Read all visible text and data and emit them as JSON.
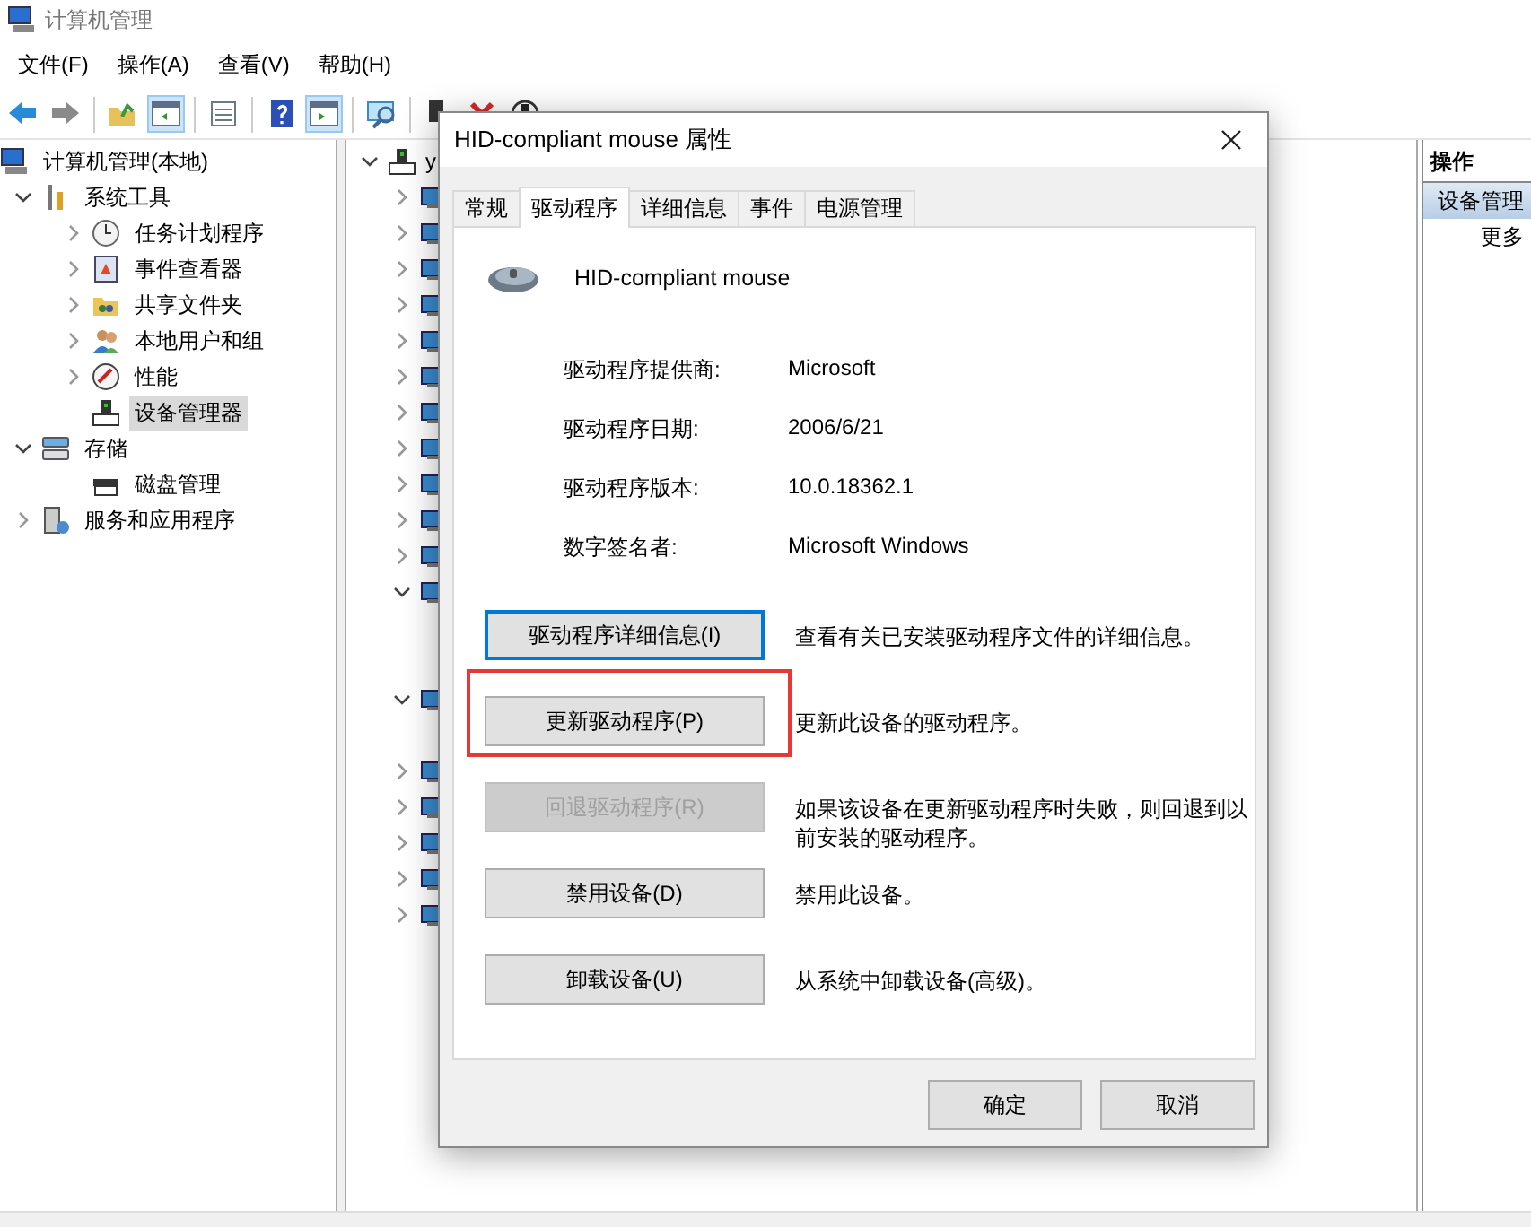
{
  "window": {
    "title": "计算机管理"
  },
  "menu": [
    "文件(F)",
    "操作(A)",
    "查看(V)",
    "帮助(H)"
  ],
  "toolbar": [
    {
      "kind": "back",
      "pressed": false
    },
    {
      "kind": "forward",
      "pressed": false
    },
    {
      "kind": "sep"
    },
    {
      "kind": "up",
      "pressed": false
    },
    {
      "kind": "tree",
      "pressed": true
    },
    {
      "kind": "sep"
    },
    {
      "kind": "export",
      "pressed": false
    },
    {
      "kind": "sep"
    },
    {
      "kind": "help",
      "pressed": false
    },
    {
      "kind": "pane",
      "pressed": true
    },
    {
      "kind": "sep"
    },
    {
      "kind": "scan",
      "pressed": false
    },
    {
      "kind": "sep"
    },
    {
      "kind": "enable",
      "pressed": false
    },
    {
      "kind": "remove",
      "pressed": false
    },
    {
      "kind": "disable",
      "pressed": false
    }
  ],
  "nav_tree": {
    "label": "计算机管理(本地)",
    "selected": false,
    "children": [
      {
        "label": "系统工具",
        "selected": false,
        "expanded": true,
        "children": [
          {
            "label": "任务计划程序",
            "selected": false,
            "expanded": false
          },
          {
            "label": "事件查看器",
            "selected": false,
            "expanded": false
          },
          {
            "label": "共享文件夹",
            "selected": false,
            "expanded": false
          },
          {
            "label": "本地用户和组",
            "selected": false,
            "expanded": false
          },
          {
            "label": "性能",
            "selected": false,
            "expanded": false
          },
          {
            "label": "设备管理器",
            "selected": true
          }
        ]
      },
      {
        "label": "存储",
        "selected": false,
        "expanded": true,
        "children": [
          {
            "label": "磁盘管理",
            "selected": false
          }
        ]
      },
      {
        "label": "服务和应用程序",
        "selected": false,
        "expanded": false
      }
    ]
  },
  "device_tree": {
    "label": "y",
    "expanded": true,
    "categories": [
      {
        "expanded": false
      },
      {
        "expanded": false
      },
      {
        "expanded": false
      },
      {
        "expanded": false
      },
      {
        "expanded": false
      },
      {
        "expanded": false
      },
      {
        "expanded": false
      },
      {
        "expanded": false
      },
      {
        "expanded": false
      },
      {
        "expanded": false
      },
      {
        "expanded": false
      },
      {
        "expanded": true,
        "children": [
          {
            "kind": "device"
          },
          {
            "kind": "device"
          }
        ]
      },
      {
        "expanded": true,
        "children": [
          {
            "kind": "device"
          }
        ]
      },
      {
        "expanded": false
      },
      {
        "expanded": false
      },
      {
        "expanded": false
      },
      {
        "expanded": false
      },
      {
        "expanded": false
      }
    ]
  },
  "actions": {
    "header": "操作",
    "items": [
      {
        "label": "设备管理",
        "selected": true
      },
      {
        "label": "更多",
        "selected": false
      }
    ]
  },
  "dialog": {
    "title": "HID-compliant mouse 属性",
    "tabs": [
      {
        "label": "常规",
        "selected": false
      },
      {
        "label": "驱动程序",
        "selected": true
      },
      {
        "label": "详细信息",
        "selected": false
      },
      {
        "label": "事件",
        "selected": false
      },
      {
        "label": "电源管理",
        "selected": false
      }
    ],
    "device_name": "HID-compliant mouse",
    "info": [
      {
        "label": "驱动程序提供商:",
        "value": "Microsoft"
      },
      {
        "label": "驱动程序日期:",
        "value": "2006/6/21"
      },
      {
        "label": "驱动程序版本:",
        "value": "10.0.18362.1"
      },
      {
        "label": "数字签名者:",
        "value": "Microsoft Windows"
      }
    ],
    "actions": [
      {
        "button": "驱动程序详细信息(I)",
        "description": "查看有关已安装驱动程序文件的详细信息。",
        "focused": true,
        "disabled": false,
        "highlighted": false
      },
      {
        "button": "更新驱动程序(P)",
        "description": "更新此设备的驱动程序。",
        "focused": false,
        "disabled": false,
        "highlighted": true
      },
      {
        "button": "回退驱动程序(R)",
        "description": "如果该设备在更新驱动程序时失败，则回退到以前安装的驱动程序。",
        "focused": false,
        "disabled": true,
        "highlighted": false
      },
      {
        "button": "禁用设备(D)",
        "description": "禁用此设备。",
        "focused": false,
        "disabled": false,
        "highlighted": false
      },
      {
        "button": "卸载设备(U)",
        "description": "从系统中卸载设备(高级)。",
        "focused": false,
        "disabled": false,
        "highlighted": false
      }
    ],
    "buttons": [
      "确定",
      "取消"
    ]
  }
}
